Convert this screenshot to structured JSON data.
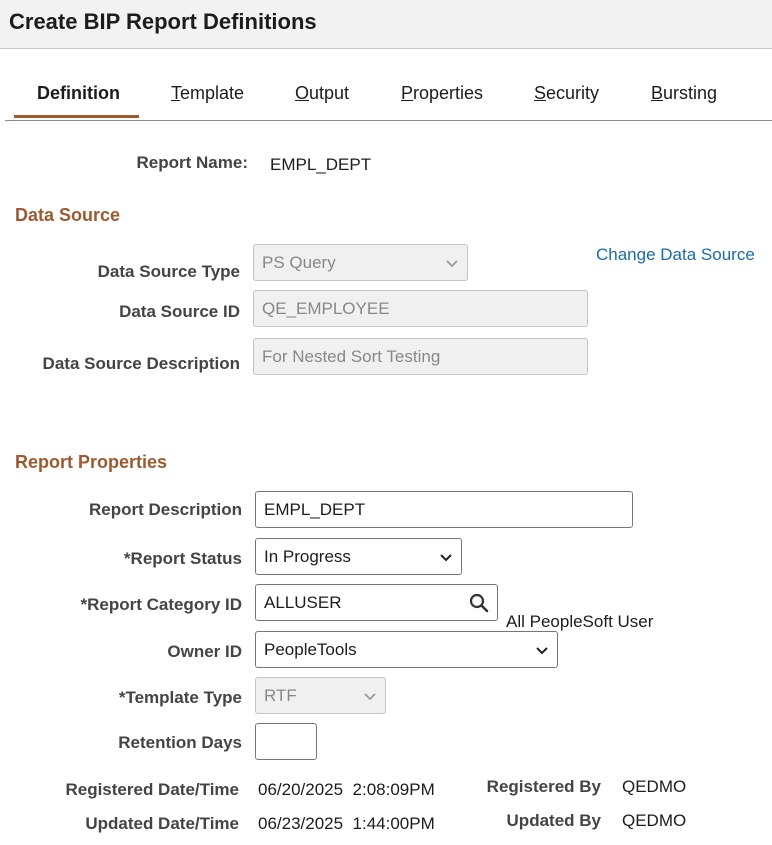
{
  "page": {
    "title": "Create BIP Report Definitions"
  },
  "tabs": [
    {
      "label_ak": "",
      "label_rest": "Definition",
      "active": true
    },
    {
      "label_ak": "T",
      "label_rest": "emplate",
      "active": false
    },
    {
      "label_ak": "O",
      "label_rest": "utput",
      "active": false
    },
    {
      "label_ak": "P",
      "label_rest": "roperties",
      "active": false
    },
    {
      "label_ak": "S",
      "label_rest": "ecurity",
      "active": false
    },
    {
      "label_ak": "B",
      "label_rest": "ursting",
      "active": false
    }
  ],
  "report_name": {
    "label": "Report Name:",
    "value": "EMPL_DEPT"
  },
  "data_source": {
    "heading": "Data Source",
    "change_link": "Change Data Source",
    "type": {
      "label": "Data Source Type",
      "value": "PS Query"
    },
    "id": {
      "label": "Data Source ID",
      "value": "QE_EMPLOYEE"
    },
    "description": {
      "label": "Data Source Description",
      "value": "For Nested Sort Testing"
    }
  },
  "report_properties": {
    "heading": "Report Properties",
    "description": {
      "label": "Report Description",
      "value": "EMPL_DEPT"
    },
    "status": {
      "label": "*Report Status",
      "value": "In Progress"
    },
    "category": {
      "label": "*Report Category ID",
      "value": "ALLUSER",
      "desc": "All PeopleSoft User"
    },
    "owner": {
      "label": "Owner ID",
      "value": "PeopleTools"
    },
    "template_type": {
      "label": "*Template Type",
      "value": "RTF"
    },
    "retention": {
      "label": "Retention Days",
      "value": ""
    },
    "registered_datetime": {
      "label": "Registered Date/Time",
      "value": "06/20/2025  2:08:09PM"
    },
    "registered_by": {
      "label": "Registered By",
      "value": "QEDMO"
    },
    "updated_datetime": {
      "label": "Updated Date/Time",
      "value": "06/23/2025  1:44:00PM"
    },
    "updated_by": {
      "label": "Updated By",
      "value": "QEDMO"
    }
  },
  "colors": {
    "accent": "#9c5a31",
    "link": "#1a6aa3"
  },
  "icons": {
    "search": "search-icon",
    "dropdown": "chevron-down-icon"
  }
}
